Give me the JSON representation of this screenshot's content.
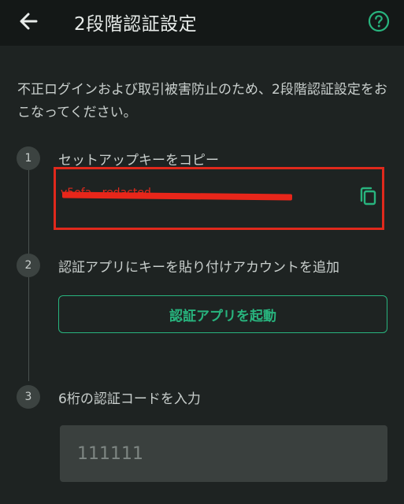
{
  "header": {
    "title": "2段階認証設定"
  },
  "description": "不正ログインおよび取引被害防止のため、2段階認証設定をおこなってください。",
  "steps": [
    {
      "number": "1",
      "label": "セットアップキーをコピー"
    },
    {
      "number": "2",
      "label": "認証アプリにキーを貼り付けアカウントを追加"
    },
    {
      "number": "3",
      "label": "6桁の認証コードを入力"
    }
  ],
  "setup_key": {
    "value": "v5ofa...redacted"
  },
  "launch_button": {
    "label": "認証アプリを起動"
  },
  "code_input": {
    "placeholder": "111111"
  },
  "colors": {
    "accent": "#28b47e",
    "highlight": "#e0291c",
    "background": "#1e2322",
    "header": "#141817"
  },
  "icons": {
    "back": "arrow-left-icon",
    "help": "question-circle-icon",
    "copy": "copy-icon"
  }
}
